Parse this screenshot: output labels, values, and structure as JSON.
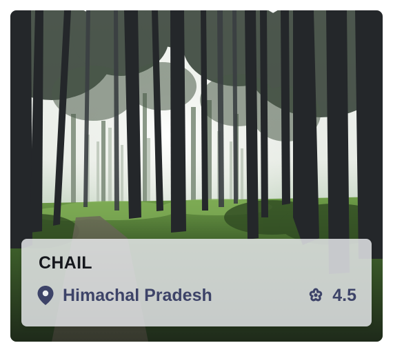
{
  "card": {
    "image_description_icon": "forest-photo",
    "title": "CHAIL",
    "location": "Himachal Pradesh",
    "location_icon": "map-pin-icon",
    "rating": "4.5",
    "rating_icon": "flower-icon"
  },
  "colors": {
    "title": "#15171c",
    "accent_text": "#3d4368",
    "overlay": "#ebedf0"
  }
}
